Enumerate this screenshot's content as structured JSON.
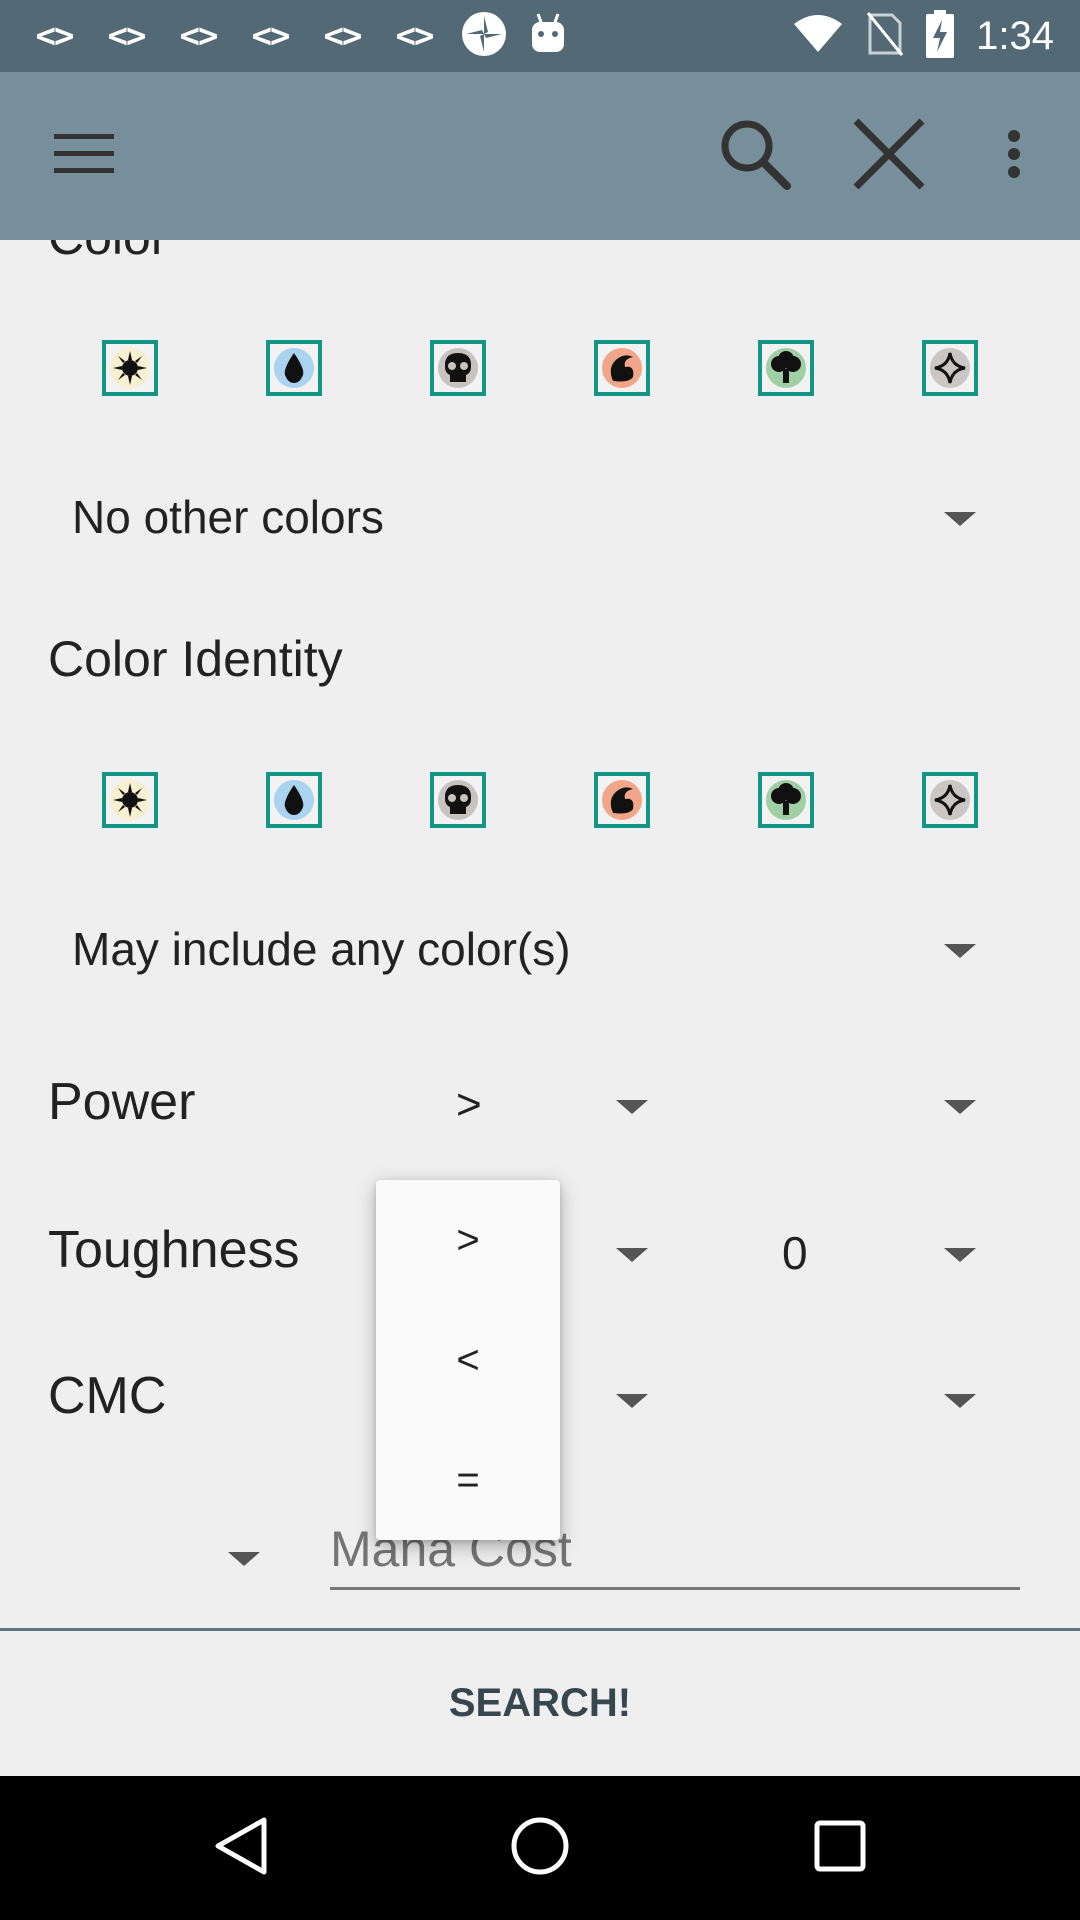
{
  "status_bar": {
    "dev_icons": [
      "<>",
      "<>",
      "<>",
      "<>",
      "<>",
      "<>"
    ],
    "time": "1:34",
    "icons": [
      "code-icon",
      "pinwheel-icon",
      "android-icon",
      "wifi-icon",
      "no-sim-icon",
      "battery-charging-icon"
    ]
  },
  "app_bar": {
    "menu_icon": "menu-icon",
    "search_icon": "search-icon",
    "close_icon": "close-icon",
    "overflow_icon": "more-vert-icon"
  },
  "color_section": {
    "label": "Color",
    "mana": [
      "white",
      "blue",
      "black",
      "red",
      "green",
      "colorless"
    ],
    "mode": "No other colors"
  },
  "color_identity": {
    "label": "Color Identity",
    "mana": [
      "white",
      "blue",
      "black",
      "red",
      "green",
      "colorless"
    ],
    "mode": "May include any color(s)"
  },
  "power": {
    "label": "Power",
    "operator": ">",
    "value": ""
  },
  "toughness": {
    "label": "Toughness",
    "operator": "",
    "value": "0"
  },
  "cmc": {
    "label": "CMC",
    "operator": "",
    "value": ""
  },
  "mana_cost": {
    "placeholder": "Mana Cost",
    "value": ""
  },
  "operator_popup": {
    "options": [
      ">",
      "<",
      "="
    ]
  },
  "search_button": "SEARCH!",
  "colors": {
    "status_bar": "#536a76",
    "app_bar": "#778f9b",
    "accent": "#129585",
    "background": "#efefef"
  }
}
